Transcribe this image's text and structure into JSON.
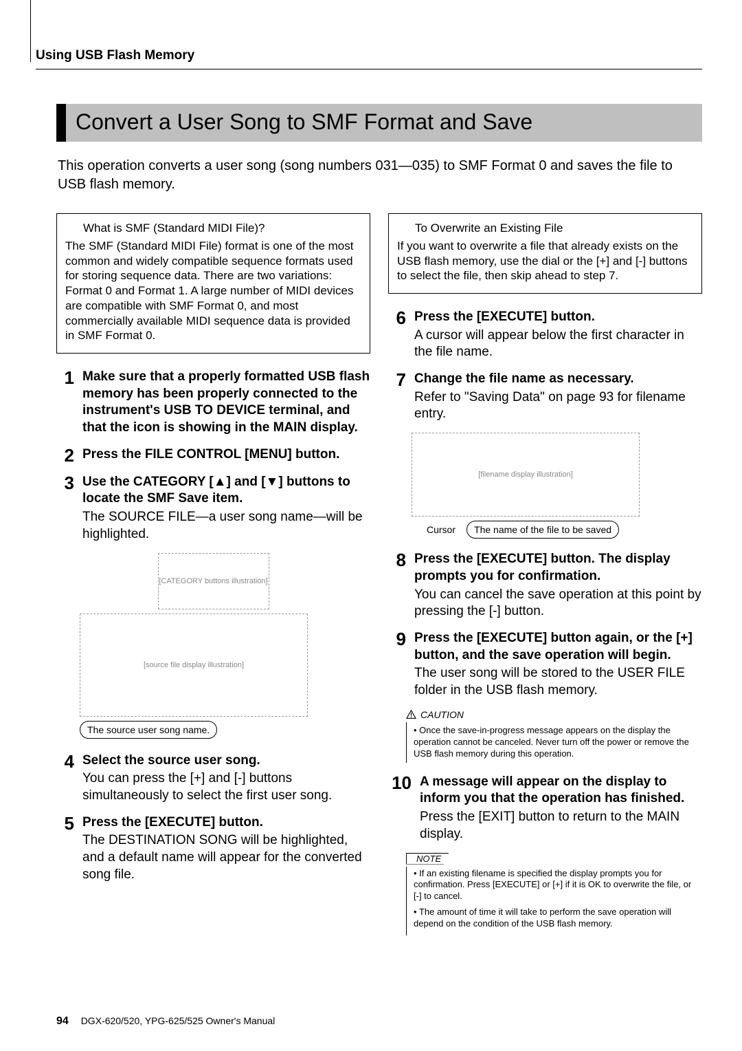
{
  "running_head": "Using USB Flash Memory",
  "title": "Convert a User Song to SMF Format and Save",
  "intro": "This operation converts a user song (song numbers 031—035) to SMF Format 0 and saves the ﬁle to USB ﬂash memory.",
  "smf_box": {
    "title": "What is SMF (Standard MIDI File)?",
    "body": "The SMF (Standard MIDI File) format is one of the most common and widely compatible sequence formats used for storing sequence data. There are two variations: Format 0 and Format 1. A large number of MIDI devices are compatible with SMF Format 0, and most commercially available MIDI sequence data is provided in SMF Format 0."
  },
  "overwrite_box": {
    "title": "To Overwrite an Existing File",
    "body": "If you want to overwrite a ﬁle that already exists on the USB ﬂash memory, use the dial or the [+] and [-] buttons to select the ﬁle, then skip ahead to step 7."
  },
  "steps": {
    "s1": {
      "n": "1",
      "title": "Make sure that a properly formatted USB flash memory has been properly connected to the instrument's USB TO DEVICE terminal, and that the icon is showing in the MAIN display."
    },
    "s2": {
      "n": "2",
      "title": "Press the FILE CONTROL [MENU] button."
    },
    "s3": {
      "n": "3",
      "title_a": "Use the CATEGORY [",
      "title_b": "] and [",
      "title_c": "] buttons to locate the SMF Save item.",
      "desc": "The SOURCE FILE—a user song name—will be highlighted."
    },
    "s4": {
      "n": "4",
      "title": "Select the source user song.",
      "desc": "You can press the [+] and [-] buttons simultaneously to select the ﬁrst user song."
    },
    "s5": {
      "n": "5",
      "title": "Press the [EXECUTE] button.",
      "desc": "The DESTINATION SONG will be highlighted, and a default name will appear for the converted song ﬁle."
    },
    "s6": {
      "n": "6",
      "title": "Press the [EXECUTE] button.",
      "desc": "A cursor will appear below the ﬁrst character in the ﬁle name."
    },
    "s7": {
      "n": "7",
      "title": "Change the file name as necessary.",
      "desc": "Refer to \"Saving Data\" on page 93 for ﬁlename entry."
    },
    "s8": {
      "n": "8",
      "title": "Press the [EXECUTE] button. The display prompts you for confirmation.",
      "desc": "You can cancel the save operation at this point by pressing the [-] button."
    },
    "s9": {
      "n": "9",
      "title": "Press the [EXECUTE] button again, or the [+] button, and the save operation will begin.",
      "desc": "The user song will be stored to the USER FILE folder in the USB ﬂash memory."
    },
    "s10": {
      "n": "10",
      "title": "A message will appear on the display to inform you that the operation has finished.",
      "desc": "Press the [EXIT] button to return to the MAIN display."
    }
  },
  "callouts": {
    "source_name": "The source user song name.",
    "cursor": "Cursor",
    "filename": "The name of the file to be saved"
  },
  "caution": {
    "label": "CAUTION",
    "text": "• Once the save-in-progress message appears on the display the operation cannot be canceled. Never turn off the power or remove the USB ﬂash memory during this operation."
  },
  "note": {
    "label": "NOTE",
    "p1": "• If an existing ﬁlename is speciﬁed the display prompts you for conﬁrmation. Press [EXECUTE] or [+] if it is OK to overwrite the ﬁle, or [-] to cancel.",
    "p2": "• The amount of time it will take to perform the save operation will depend on the condition of the USB ﬂash memory."
  },
  "footer": {
    "page": "94",
    "manual": "DGX-620/520, YPG-625/525  Owner's Manual"
  },
  "fig": {
    "cat": "[CATEGORY buttons illustration]",
    "src": "[source file display illustration]",
    "name": "[filename display illustration]"
  }
}
